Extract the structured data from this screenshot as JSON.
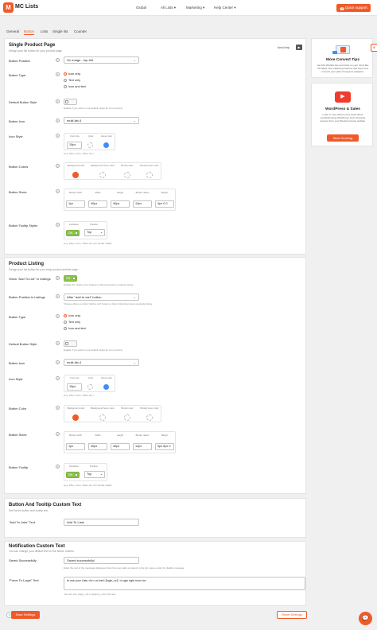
{
  "header": {
    "logo_letter": "M",
    "brand": "MC Lists",
    "nav": [
      "Global",
      "All Lists ▾",
      "Marketing ▾",
      "Help Center ▾"
    ],
    "quick_support": "Quick support"
  },
  "tabs": [
    "General",
    "Button",
    "Lists",
    "Single list",
    "Counter"
  ],
  "single": {
    "title": "Single Product Page",
    "sub": "Design your list button for your product page",
    "need_help": "Need Help",
    "position_label": "Button Position",
    "position_value": "On image - top left",
    "type_label": "Button Type",
    "type_options": [
      "Icon only",
      "Text only",
      "Icon and text"
    ],
    "style_label": "Default Button Style",
    "style_hint": "Enable if you want to use default styles for icon and text",
    "icon_label": "Button Icon",
    "icon_value": "multi-list-4",
    "icon_style_label": "Icon Style",
    "icon_style_cols": [
      "Font size",
      "Color",
      "Hover color"
    ],
    "icon_style_size": "15px",
    "unit_hint": "(e.g. 15px, 1rem, 10em etc.)",
    "colors_label": "Button Colors",
    "colors_cols": [
      "Background color",
      "Background hover color",
      "Border color",
      "Border hover color"
    ],
    "sizes_label": "Button Sizes",
    "sizes_cols": [
      "Border width",
      "Width",
      "Height",
      "Border radius",
      "Margin"
    ],
    "sizes_values": [
      "1px",
      "40px",
      "40px",
      "12px",
      "4px 0 0"
    ],
    "tooltip_label": "Button Tooltip Styles",
    "tooltip_cols": [
      "Activation",
      "Position"
    ],
    "tooltip_on": "ON",
    "tooltip_pos": "Top",
    "tooltip_hint": "(e.g. 15px, 1rem, 10em etc.) for border radius"
  },
  "listing": {
    "title": "Product Listing",
    "sub": "Design your list button for your shop product archive page",
    "show_label": "Show \"Add To List\" in Listings",
    "show_on": "ON",
    "show_hint": "Enable the \"Add to List\" feature in WooCommerce products listing",
    "position_label": "Button Position in Listings",
    "position_value": "After \"add to cart\" button",
    "position_hint": "Choose where to show \"Add to List\" button or link in WooCommerce products listing",
    "type_label": "Button Type",
    "type_options": [
      "Icon only",
      "Text only",
      "Icon and text"
    ],
    "style_label": "Default Button Style",
    "style_hint": "Enable if you want to use default styles for icon and text",
    "icon_label": "Button Icon",
    "icon_value": "multi-list-4",
    "icon_style_label": "Icon Style",
    "icon_style_cols": [
      "Font size",
      "Color",
      "Hover color"
    ],
    "icon_style_size": "15px",
    "unit_hint": "(e.g. 15px, 1rem, 10em etc.)",
    "colors_label": "Button Color",
    "colors_cols": [
      "Background color",
      "Background hover color",
      "Border color",
      "Border hover color"
    ],
    "sizes_label": "Button Sizes",
    "sizes_cols": [
      "Border width",
      "Width",
      "Height",
      "Border radius",
      "Margin"
    ],
    "sizes_values": [
      "1px",
      "40px",
      "40px",
      "12px",
      "5px 5px 0"
    ],
    "tooltip_label": "Button Tooltip",
    "tooltip_cols": [
      "Activation",
      "Position"
    ],
    "tooltip_on": "ON",
    "tooltip_pos": "Top",
    "tooltip_hint": "(e.g. 15px, 1rem, 10em etc.) for border radius"
  },
  "custom_text": {
    "title": "Button And Tooltip Custom Text",
    "sub": "Set the list button and tooltip text",
    "add_label": "\"Add To Lists\" Text",
    "add_value": "Add To Lists"
  },
  "notification": {
    "title": "Notification Custom Text",
    "sub": "You can change your default text for the above notices",
    "saved_label": "Saved Successfully",
    "saved_value": "Saved successfully!",
    "saved_hint": "Enter the text of the message displayed when the user adds a product to the list. leave empty for disable message",
    "login_label": "\"Force To Login\" Text",
    "login_value": "to use your Lists <br><a href='{login_url}' >Login right now</a>",
    "login_hint": "You can use: {login_url} or {signup_url} in the text"
  },
  "sidebar": {
    "tips_title": "More Convert Tips",
    "tips_text": "Get MC Wishlist tips and tricks on your inbox like the latest new marketing features and learn how to boost your sales through its analytics.",
    "yt_title": "WordPress & Sales",
    "yt_text": "Learn in new videos every week about troubleshooting WordPress and increasing revenue from your WooCommerce website.",
    "yt_button": "Start Growing"
  },
  "footer": {
    "save": "Save Settings",
    "reset": "Reset Settings"
  },
  "colors": {
    "accent": "#f05a28",
    "blue": "#3d8ef8",
    "green": "#8bc34a"
  }
}
